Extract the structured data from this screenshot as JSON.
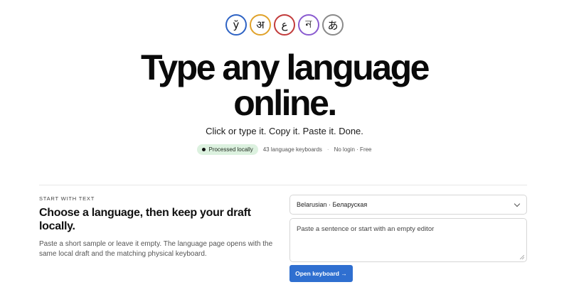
{
  "logo": {
    "glyphs": [
      {
        "char": "ў",
        "color": "#2e63c4"
      },
      {
        "char": "अ",
        "color": "#e0a22a"
      },
      {
        "char": "ع",
        "color": "#c23b3b"
      },
      {
        "char": "ন",
        "color": "#8a5bd0"
      },
      {
        "char": "あ",
        "color": "#8a8a8a"
      }
    ]
  },
  "hero": {
    "headline_line1": "Type any language",
    "headline_line2": "online.",
    "tagline": "Click or type it. Copy it. Paste it. Done."
  },
  "meta": {
    "badge": "Processed locally",
    "keyboards": "43 language keyboards",
    "separator": "·",
    "login": "No login · Free"
  },
  "start": {
    "eyebrow": "START WITH TEXT",
    "title": "Choose a language, then keep your draft locally.",
    "description": "Paste a short sample or leave it empty. The language page opens with the same local draft and the matching physical keyboard.",
    "language_select": {
      "value": "Belarusian · Беларуская"
    },
    "draft_input": {
      "value": "",
      "placeholder": "Paste a sentence or start with an empty editor"
    },
    "open_button": "Open keyboard →"
  },
  "colors": {
    "accent": "#2f6fd0",
    "badge_bg": "#dcf1df"
  }
}
